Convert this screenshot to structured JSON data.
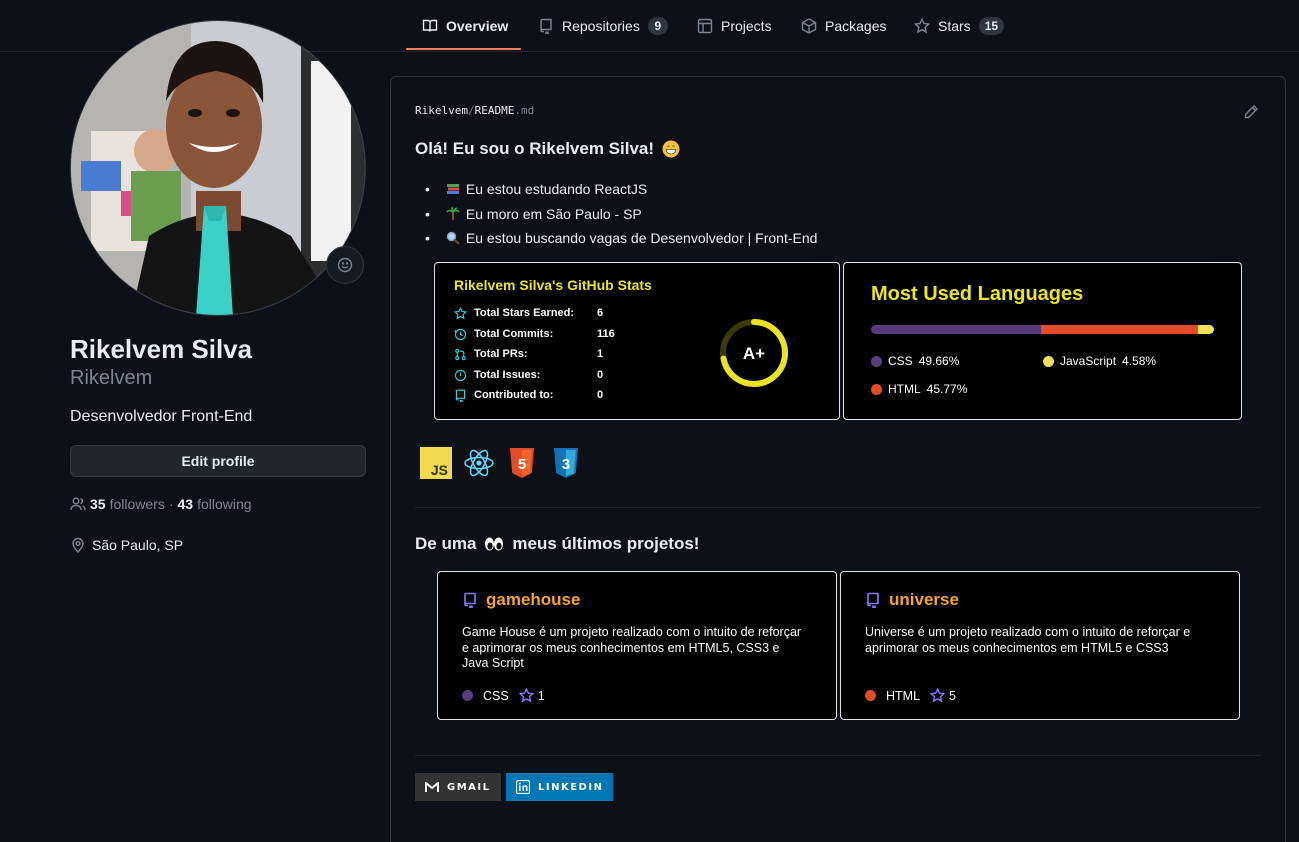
{
  "nav": {
    "tabs": [
      {
        "label": "Overview",
        "icon": "book-icon",
        "active": true
      },
      {
        "label": "Repositories",
        "icon": "repo-icon",
        "count": "9"
      },
      {
        "label": "Projects",
        "icon": "table-icon"
      },
      {
        "label": "Packages",
        "icon": "package-icon"
      },
      {
        "label": "Stars",
        "icon": "star-icon",
        "count": "15"
      }
    ]
  },
  "profile": {
    "fullname": "Rikelvem Silva",
    "login": "Rikelvem",
    "bio": "Desenvolvedor Front-End",
    "edit_label": "Edit profile",
    "followers_count": "35",
    "followers_label": "followers",
    "separator": "·",
    "following_count": "43",
    "following_label": "following",
    "location": "São Paulo, SP"
  },
  "readme": {
    "owner": "Rikelvem",
    "slash": "/",
    "file": "README",
    "ext": ".md",
    "greeting": "Olá! Eu sou o Rikelvem Silva!",
    "bullets": [
      "Eu estou estudando ReactJS",
      "Eu moro em São Paulo - SP",
      "Eu estou buscando vagas de Desenvolvedor | Front-End"
    ],
    "projects_heading_pre": "De uma",
    "projects_heading_post": "meus últimos projetos!"
  },
  "stats": {
    "title": "Rikelvem Silva's GitHub Stats",
    "rows": [
      {
        "label": "Total Stars Earned:",
        "value": "6",
        "icon": "star-icon"
      },
      {
        "label": "Total Commits:",
        "value": "116",
        "icon": "history-icon"
      },
      {
        "label": "Total PRs:",
        "value": "1",
        "icon": "pull-request-icon"
      },
      {
        "label": "Total Issues:",
        "value": "0",
        "icon": "issue-icon"
      },
      {
        "label": "Contributed to:",
        "value": "0",
        "icon": "repo-icon"
      }
    ],
    "rank": "A+",
    "rank_progress": 0.72,
    "title_color": "#ebe422",
    "icon_color": "#27d5df"
  },
  "languages": {
    "title": "Most Used Languages",
    "items": [
      {
        "name": "CSS",
        "percent": "49.66%",
        "value": 49.66,
        "color": "#563d7c"
      },
      {
        "name": "HTML",
        "percent": "45.77%",
        "value": 45.77,
        "color": "#e34c26"
      },
      {
        "name": "JavaScript",
        "percent": "4.58%",
        "value": 4.58,
        "color": "#f1e05a"
      }
    ]
  },
  "tech_icons": [
    "javascript-icon",
    "react-icon",
    "html5-icon",
    "css3-icon"
  ],
  "tech_text": {
    "js": "JS",
    "html": "5",
    "css": "3"
  },
  "projects": [
    {
      "name": "gamehouse",
      "description": "Game House é um projeto realizado com o intuito de reforçar e aprimorar os meus conhecimentos em HTML5, CSS3 e Java Script",
      "language": "CSS",
      "lang_color": "#563d7c",
      "stars": "1"
    },
    {
      "name": "universe",
      "description": "Universe é um projeto realizado com o intuito de reforçar e aprimorar os meus conhecimentos em HTML5 e CSS3",
      "language": "HTML",
      "lang_color": "#e34c26",
      "stars": "5"
    }
  ],
  "badges": [
    {
      "label": "GMAIL",
      "color": "#333333",
      "icon": "gmail-icon"
    },
    {
      "label": "LINKEDIN",
      "color": "#0077b5",
      "icon": "linkedin-icon"
    }
  ],
  "colors": {
    "background": "#0d1117",
    "accent_underline": "#f78166",
    "project_title": "#f5a623",
    "project_icon": "#8a78ff"
  }
}
